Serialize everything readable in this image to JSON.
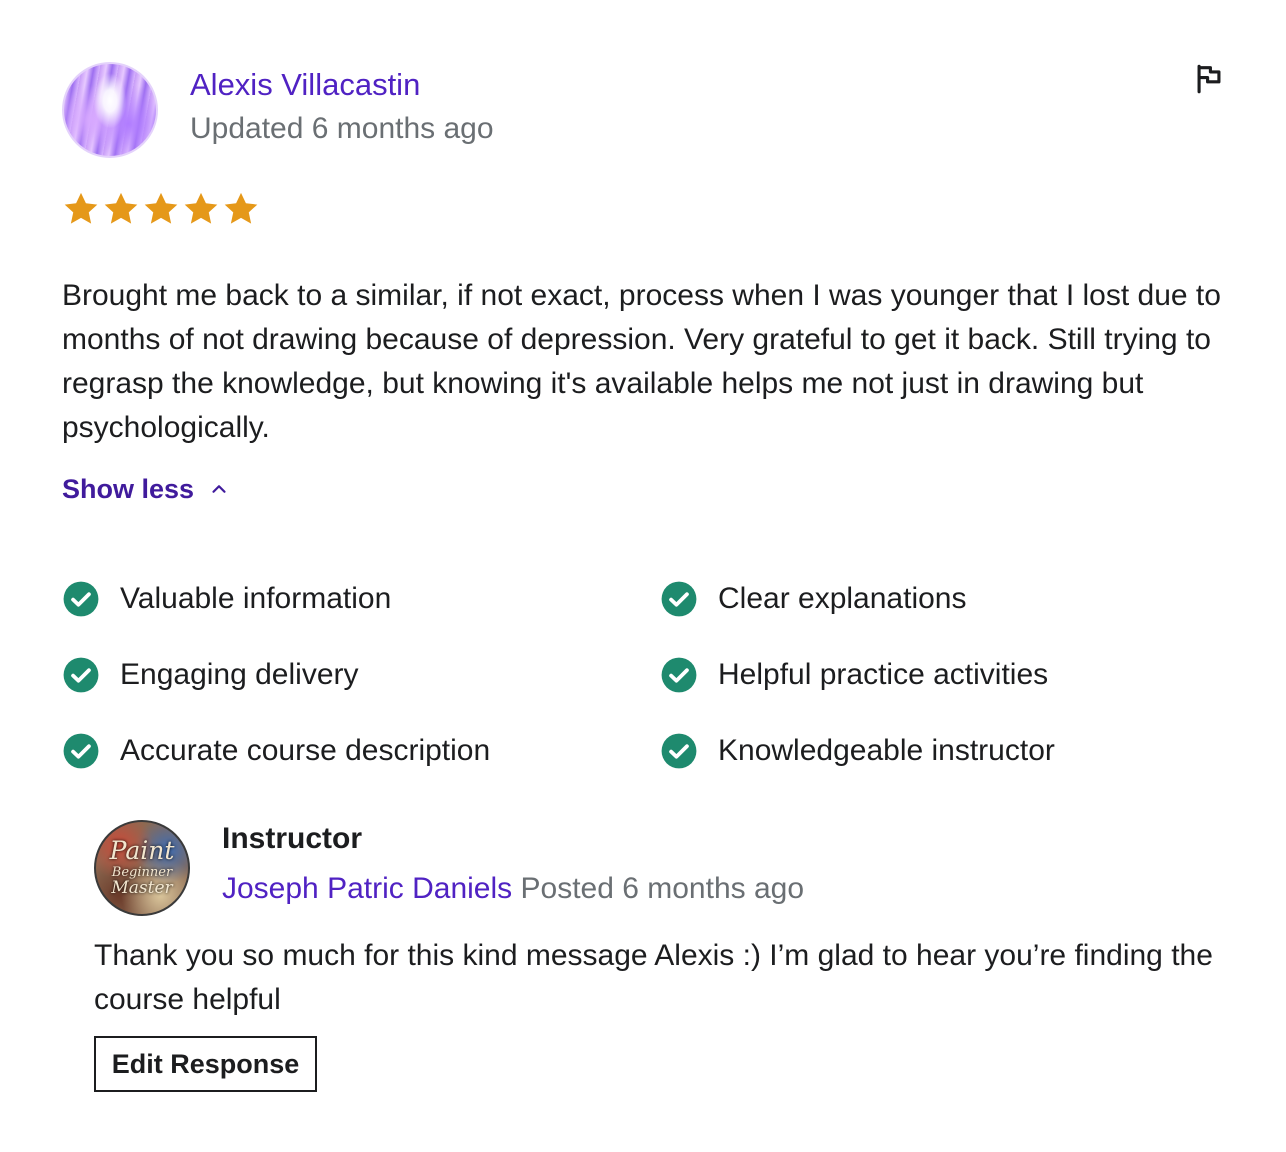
{
  "review": {
    "author_name": "Alexis Villacastin",
    "updated_text": "Updated 6 months ago",
    "rating": 5,
    "rating_max": 5,
    "star_color": "#e59819",
    "text": "Brought me back to a similar, if not exact, process when I was younger that I lost due to months of not drawing because of depression. Very grateful to get it back. Still trying to regrasp the knowledge, but knowing it's available helps me not just in drawing but psychologically.",
    "show_less_label": "Show less",
    "flag_icon": "flag-icon",
    "attributes": [
      "Valuable information",
      "Clear explanations",
      "Engaging delivery",
      "Helpful practice activities",
      "Accurate course description",
      "Knowledgeable instructor"
    ],
    "check_color": "#1e8a6e"
  },
  "response": {
    "role": "Instructor",
    "name": "Joseph Patric Daniels",
    "posted_text": "Posted 6 months ago",
    "avatar_lettering": [
      "Paint",
      "Beginner",
      "Master"
    ],
    "text": "Thank you so much for this kind message Alexis :) I’m glad to hear you’re finding the course helpful",
    "edit_label": "Edit Response"
  },
  "colors": {
    "link_purple": "#5022c3",
    "show_less_purple": "#401b9c",
    "muted_gray": "#6a6f73",
    "text_dark": "#1c1d1f"
  }
}
